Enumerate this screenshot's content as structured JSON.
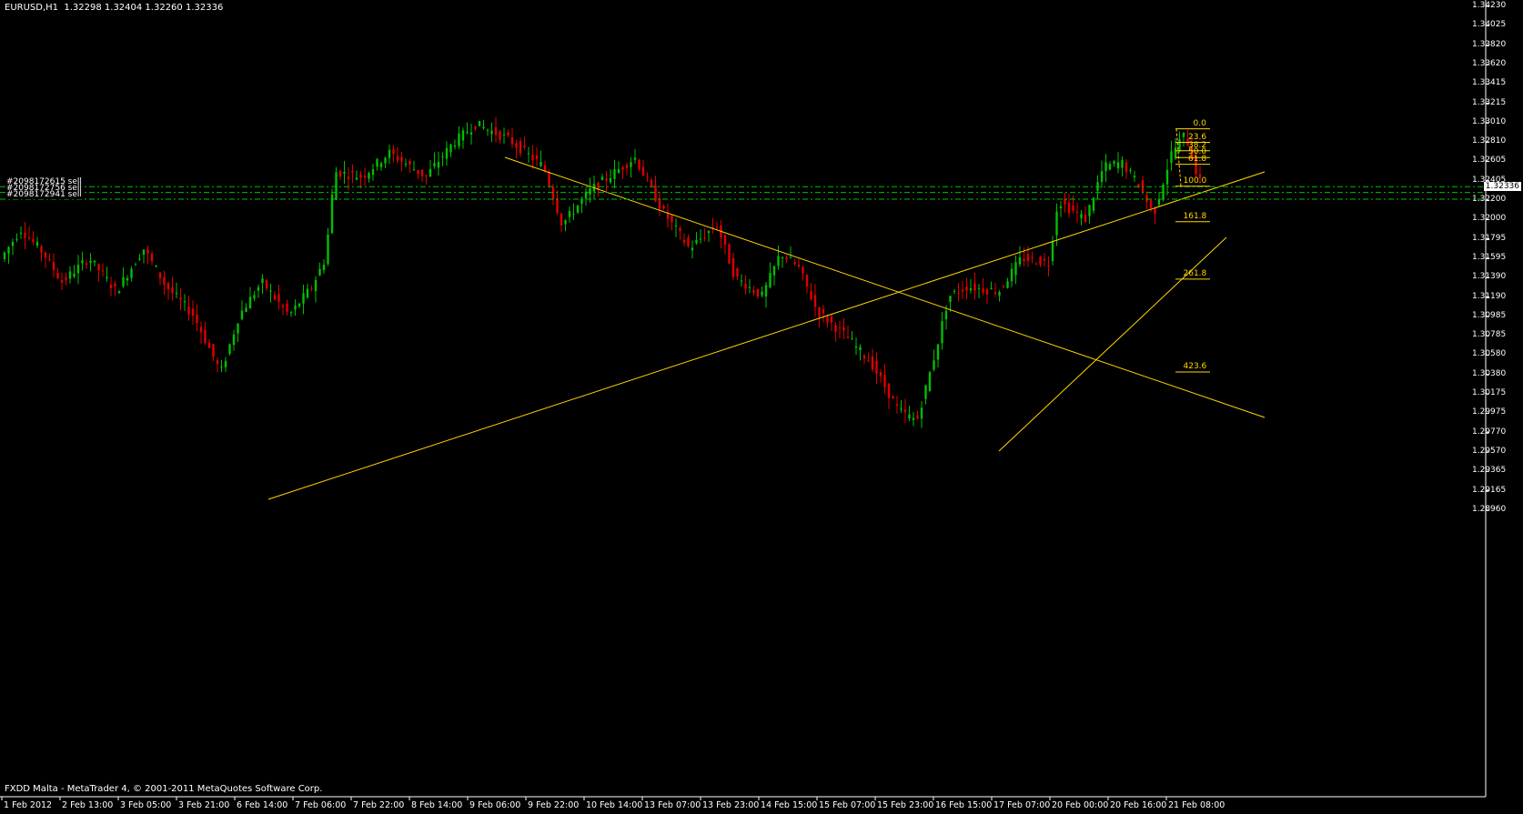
{
  "header": {
    "symbol_info": "EURUSD,H1  1.32298 1.32404 1.32260 1.32336"
  },
  "footer": {
    "copyright": "FXDD Malta - MetaTrader 4, © 2001-2011 MetaQuotes Software Corp."
  },
  "price_axis": {
    "labels": [
      "1.34230",
      "1.34025",
      "1.33820",
      "1.33620",
      "1.33415",
      "1.33215",
      "1.33010",
      "1.32810",
      "1.32605",
      "1.32405",
      "1.32200",
      "1.32000",
      "1.31795",
      "1.31595",
      "1.31390",
      "1.31190",
      "1.30985",
      "1.30785",
      "1.30580",
      "1.30380",
      "1.30175",
      "1.29975",
      "1.29770",
      "1.29570",
      "1.29365",
      "1.29165",
      "1.28960"
    ],
    "current_price": "1.32336"
  },
  "time_axis": {
    "labels": [
      "1 Feb 2012",
      "2 Feb 13:00",
      "3 Feb 05:00",
      "3 Feb 21:00",
      "6 Feb 14:00",
      "7 Feb 06:00",
      "7 Feb 22:00",
      "8 Feb 14:00",
      "9 Feb 06:00",
      "9 Feb 22:00",
      "10 Feb 14:00",
      "13 Feb 07:00",
      "13 Feb 23:00",
      "14 Feb 15:00",
      "15 Feb 07:00",
      "15 Feb 23:00",
      "16 Feb 15:00",
      "17 Feb 07:00",
      "20 Feb 00:00",
      "20 Feb 16:00",
      "21 Feb 08:00"
    ]
  },
  "orders": [
    {
      "label": "#2098172615 sell",
      "price": 1.32345
    },
    {
      "label": "#2098172756 sell",
      "price": 1.32285
    },
    {
      "label": "#2098172941 sell",
      "price": 1.32215
    }
  ],
  "fibonacci": {
    "levels": [
      "0.0",
      "23.6",
      "38.2",
      "50.0",
      "61.8",
      "100.0",
      "161.8",
      "261.8",
      "423.6"
    ],
    "high": 1.3295,
    "low": 1.3235
  },
  "colors": {
    "bull": "#00c000",
    "bear": "#e00000",
    "trendline": "#ffd700",
    "order_line": "#00c000",
    "axis": "#ffffff"
  }
}
